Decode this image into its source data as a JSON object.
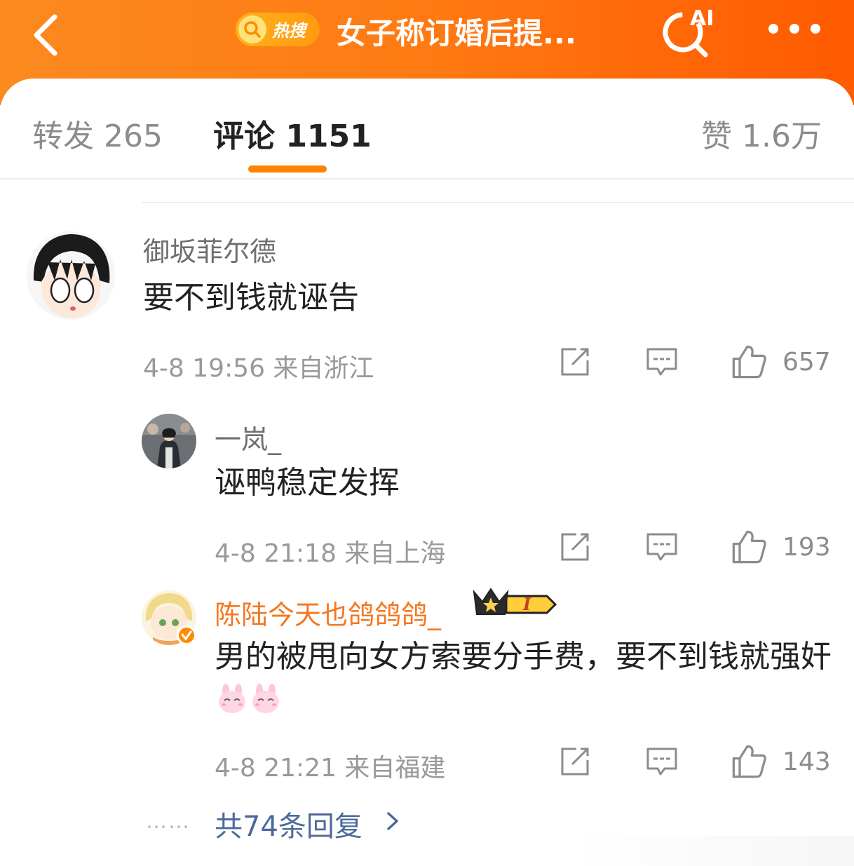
{
  "header": {
    "hot_badge": "热搜",
    "title": "女子称订婚后提...",
    "ai_label": "AI"
  },
  "tabs": {
    "reposts": "转发 265",
    "comments": "评论 1151",
    "likes": "赞 1.6万"
  },
  "comments": [
    {
      "username": "御坂菲尔德",
      "text": "要不到钱就诬告",
      "meta": "4-8 19:56  来自浙江",
      "likes": "657"
    },
    {
      "username": "一岚_",
      "text": "诬鸭稳定发挥",
      "meta": "4-8 21:18  来自上海",
      "likes": "193"
    },
    {
      "username": "陈陆今天也鸽鸽鸽_",
      "text": "男的被甩向女方索要分手费，要不到钱就强奸",
      "meta": "4-8 21:21  来自福建",
      "likes": "143",
      "vip_level": "I"
    }
  ],
  "more_replies": {
    "dots": "……",
    "label": "共74条回复"
  },
  "colors": {
    "header_start": "#fb8a1f",
    "header_end": "#ff5a00",
    "accent": "#ff8200",
    "link": "#4b6a9b",
    "vip_name": "#f57820"
  }
}
